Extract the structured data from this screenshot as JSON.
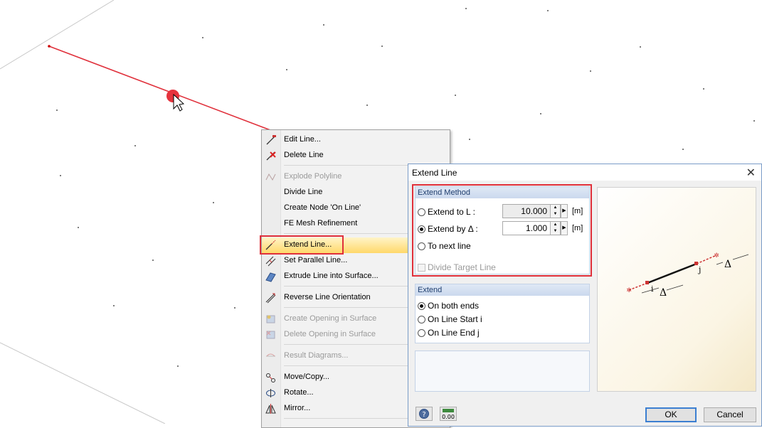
{
  "context_menu": {
    "items": [
      {
        "label": "Edit Line...",
        "icon": "edit-line-icon",
        "enabled": true
      },
      {
        "label": "Delete Line",
        "icon": "delete-line-icon",
        "enabled": true
      },
      {
        "label": "Explode Polyline",
        "icon": "explode-polyline-icon",
        "enabled": false
      },
      {
        "label": "Divide Line",
        "icon": "",
        "enabled": true
      },
      {
        "label": "Create Node 'On Line'",
        "icon": "",
        "enabled": true
      },
      {
        "label": "FE Mesh Refinement",
        "icon": "",
        "enabled": true
      },
      {
        "label": "Extend Line...",
        "icon": "extend-line-icon",
        "enabled": true,
        "highlighted": true
      },
      {
        "label": "Set Parallel Line...",
        "icon": "parallel-line-icon",
        "enabled": true
      },
      {
        "label": "Extrude Line into Surface...",
        "icon": "extrude-icon",
        "enabled": true
      },
      {
        "label": "Reverse Line Orientation",
        "icon": "reverse-orientation-icon",
        "enabled": true
      },
      {
        "label": "Create Opening in Surface",
        "icon": "create-opening-icon",
        "enabled": false
      },
      {
        "label": "Delete Opening in Surface",
        "icon": "delete-opening-icon",
        "enabled": false
      },
      {
        "label": "Result Diagrams...",
        "icon": "result-diagrams-icon",
        "enabled": false
      },
      {
        "label": "Move/Copy...",
        "icon": "move-copy-icon",
        "enabled": true
      },
      {
        "label": "Rotate...",
        "icon": "rotate-icon",
        "enabled": true
      },
      {
        "label": "Mirror...",
        "icon": "mirror-icon",
        "enabled": true
      }
    ]
  },
  "dialog": {
    "title": "Extend Line",
    "method": {
      "header": "Extend Method",
      "extend_to_l_label": "Extend to L :",
      "extend_to_l_value": "10.000",
      "extend_to_l_unit": "[m]",
      "extend_by_label": "Extend by Δ :",
      "extend_by_value": "1.000",
      "extend_by_unit": "[m]",
      "to_next_line_label": "To next line",
      "divide_target_label": "Divide Target Line",
      "selected": "extend_by"
    },
    "extend": {
      "header": "Extend",
      "both_ends_label": "On both ends",
      "line_start_label": "On Line Start i",
      "line_end_label": "On Line End j",
      "selected": "both_ends"
    },
    "preview": {
      "label_i": "i",
      "label_j": "j",
      "delta": "Δ"
    },
    "ok_label": "OK",
    "cancel_label": "Cancel",
    "units_icon_text": "0.00"
  },
  "colors": {
    "line_red": "#e0303b",
    "accent_blue": "#3c7fd1"
  }
}
